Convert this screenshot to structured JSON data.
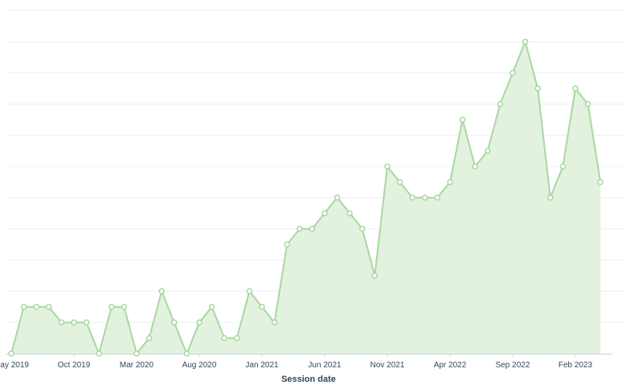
{
  "chart_data": {
    "type": "area",
    "title": "",
    "xlabel": "Session date",
    "ylabel": "",
    "ylim": [
      0,
      22
    ],
    "grid": true,
    "legend": "none",
    "x": [
      "2019-05",
      "2019-06",
      "2019-07",
      "2019-08",
      "2019-09",
      "2019-10",
      "2019-11",
      "2019-12",
      "2020-01",
      "2020-02",
      "2020-03",
      "2020-04",
      "2020-05",
      "2020-06",
      "2020-07",
      "2020-08",
      "2020-09",
      "2020-10",
      "2020-11",
      "2020-12",
      "2021-01",
      "2021-02",
      "2021-03",
      "2021-04",
      "2021-05",
      "2021-06",
      "2021-07",
      "2021-08",
      "2021-09",
      "2021-10",
      "2021-11",
      "2021-12",
      "2022-01",
      "2022-02",
      "2022-03",
      "2022-04",
      "2022-05",
      "2022-06",
      "2022-07",
      "2022-08",
      "2022-09",
      "2022-10",
      "2022-11",
      "2022-12",
      "2023-01",
      "2023-02",
      "2023-03",
      "2023-04"
    ],
    "series": [
      {
        "name": "",
        "color": "#a8d8a0",
        "fill": "#e2f2df",
        "values": [
          0,
          3,
          3,
          3,
          2,
          2,
          2,
          0,
          3,
          3,
          0,
          1,
          4,
          2,
          0,
          2,
          3,
          1,
          1,
          4,
          3,
          2,
          7,
          8,
          8,
          9,
          10,
          9,
          8,
          5,
          12,
          11,
          10,
          10,
          10,
          11,
          15,
          12,
          13,
          16,
          18,
          20,
          17,
          10,
          12,
          17,
          16,
          11
        ]
      }
    ],
    "x_ticks": [
      {
        "x": "2019-05",
        "label": "May 2019"
      },
      {
        "x": "2019-10",
        "label": "Oct 2019"
      },
      {
        "x": "2020-03",
        "label": "Mar 2020"
      },
      {
        "x": "2020-08",
        "label": "Aug 2020"
      },
      {
        "x": "2021-01",
        "label": "Jan 2021"
      },
      {
        "x": "2021-06",
        "label": "Jun 2021"
      },
      {
        "x": "2021-11",
        "label": "Nov 2021"
      },
      {
        "x": "2022-04",
        "label": "Apr 2022"
      },
      {
        "x": "2022-09",
        "label": "Sep 2022"
      },
      {
        "x": "2023-02",
        "label": "Feb 2023"
      }
    ]
  }
}
